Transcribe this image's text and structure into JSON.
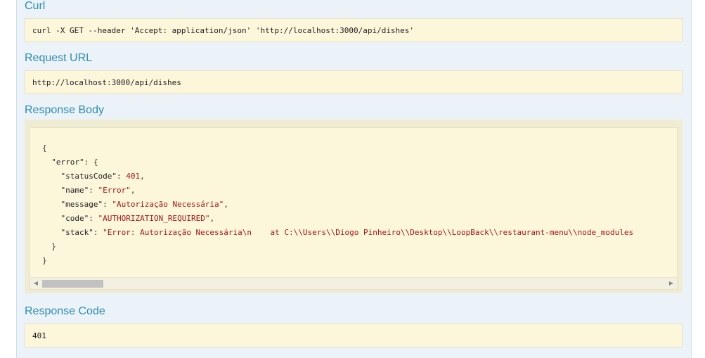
{
  "curl": {
    "heading": "Curl",
    "command": "curl -X GET --header 'Accept: application/json' 'http://localhost:3000/api/dishes'"
  },
  "request_url": {
    "heading": "Request URL",
    "value": "http://localhost:3000/api/dishes"
  },
  "response_body": {
    "heading": "Response Body",
    "open_brace": "{",
    "error_key": "\"error\"",
    "error_open": ": {",
    "fields": [
      {
        "key": "\"statusCode\"",
        "value": "401",
        "sep": ","
      },
      {
        "key": "\"name\"",
        "value": "\"Error\"",
        "sep": ","
      },
      {
        "key": "\"message\"",
        "value": "\"Autorização Necessária\"",
        "sep": ","
      },
      {
        "key": "\"code\"",
        "value": "\"AUTHORIZATION_REQUIRED\"",
        "sep": ","
      },
      {
        "key": "\"stack\"",
        "value": "\"Error: Autorização Necessária\\n    at C:\\\\Users\\\\Diogo Pinheiro\\\\Desktop\\\\LoopBack\\\\restaurant-menu\\\\node_modules",
        "sep": ""
      }
    ],
    "inner_close": "}",
    "outer_close": "}",
    "scroll_fraction": 0.1
  },
  "response_code": {
    "heading": "Response Code",
    "value": "401"
  },
  "icons": {
    "scroll_left": "arrow-left-icon",
    "scroll_right": "arrow-right-icon"
  }
}
